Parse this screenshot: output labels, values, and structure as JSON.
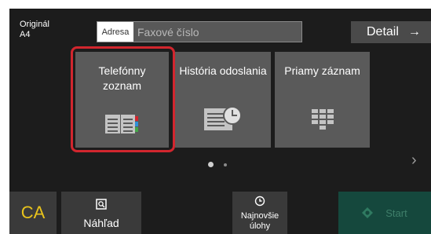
{
  "original": {
    "label": "Originál",
    "size": "A4"
  },
  "address": {
    "label": "Adresa",
    "placeholder": "Faxové číslo"
  },
  "detail": {
    "label": "Detail",
    "arrow": "→"
  },
  "tiles": [
    {
      "label": "Telefónny zoznam",
      "icon": "address-book-icon",
      "selected": true
    },
    {
      "label": "História odoslania",
      "icon": "send-history-icon",
      "selected": false
    },
    {
      "label": "Priamy záznam",
      "icon": "keypad-icon",
      "selected": false
    }
  ],
  "pager": {
    "current_page": 1,
    "total_pages": 2
  },
  "nav": {
    "next": "›"
  },
  "bottom": {
    "ca": "CA",
    "preview": "Náhľad",
    "recent_jobs": "Najnovšie úlohy",
    "start": "Start"
  },
  "colors": {
    "selection": "#d2262e",
    "ca_text": "#e8c31c",
    "start_bg": "#15483d"
  }
}
